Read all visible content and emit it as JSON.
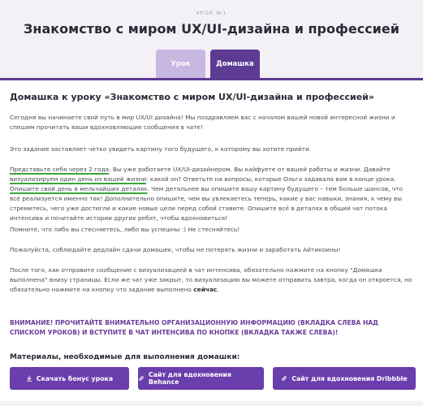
{
  "header": {
    "lesson_label": "УРОК №1",
    "title": "Знакомство с миром UX/UI-дизайна и профессией"
  },
  "tabs": [
    {
      "label": "Урок",
      "active": false
    },
    {
      "label": "Домашка",
      "active": true
    }
  ],
  "homework": {
    "title": "Домашка к уроку «Знакомство с миром UX/UI-дизайна и профессией»",
    "p1": "Сегодня вы начинаете свой путь в мир UX/UI дизайна! Мы поздравляем вас с началом вашей новой интересной жизни и спешим прочитать ваши вдохновляющие сообщения в чате!",
    "p2": "Это задание заставляет четко увидеть картину того будущего, к которому вы хотите прийти.",
    "p3": {
      "hl1": "Представьте себя через 2 года",
      "t1": ". Вы уже работаете UX/UI-дизайнером. Вы кайфуете от вашей работы и жизни. Давайте ",
      "hl2": "визуализируем один день из вашей жизни",
      "t2": ": какой он? Ответьте на вопросы, которые Ольга задавала вам в конце урока. ",
      "hl3": "Опишите свой день в мельчайших деталях",
      "t3": ". Чем детальнее вы опишите вашу картину будущего – тем больше шансов, что всё реализуется именно так! Дополнительно опишите, чем вы увлекаетесь теперь, какие у вас навыки, знания, к чему вы стремитесь, чего уже достигли и какие новые цели перед собой ставите. Опишите всё в деталях в общий чат потока интенсива и почитайте истории других ребят, чтобы вдохновиться!"
    },
    "p4": "Помните, что либо вы стесняетесь, либо вы успешны :) Не стесняйтесь!",
    "p5": "Пожалуйста, соблюдайте дедлайн сдачи домашек, чтобы не потерять жизни и заработать Айтикоины!",
    "p6_text": "После того, как отправите сообщение с визуализацией в чат интенсива, обязательно нажмите на кнопку \"Домашка выполнена\" внизу страницы. Если же чат уже закрыт, то визуализацию вы можете отправить завтра, когда он откроется, но обязательно нажмите на кнопку что задание выполнено ",
    "p6_bold": "сейчас",
    "p6_end": ".",
    "attention": "ВНИМАНИЕ! ПРОЧИТАЙТЕ ВНИМАТЕЛЬНО ОРГАНИЗАЦИОННУЮ ИНФОРМАЦИЮ (ВКЛАДКА СЛЕВА НАД СПИСКОМ УРОКОВ) И ВСТУПИТЕ В ЧАТ ИНТЕНСИВА ПО КНОПКЕ (ВКЛАДКА ТАКЖЕ СЛЕВА)!",
    "materials_title": "Материалы, необходимые для выполнения домашки:"
  },
  "buttons": [
    {
      "label": "Скачать бонус урока",
      "icon": "download-icon"
    },
    {
      "label": "Сайт для вдохновения Behance",
      "icon": "link-icon"
    },
    {
      "label": "Сайт для вдохновения Dribbble",
      "icon": "link-icon"
    }
  ],
  "colors": {
    "accent": "#5d3b93",
    "button": "#6a3eac",
    "tab_inactive": "#c8b7e0",
    "highlight_underline": "#3aa63a",
    "attention_text": "#6a3d9a"
  }
}
